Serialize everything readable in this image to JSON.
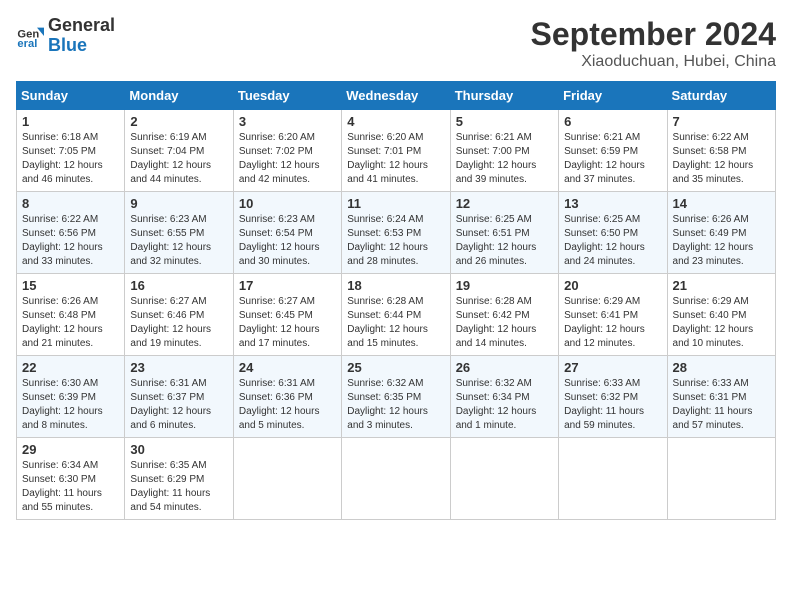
{
  "logo": {
    "line1": "General",
    "line2": "Blue"
  },
  "header": {
    "month": "September 2024",
    "location": "Xiaoduchuan, Hubei, China"
  },
  "weekdays": [
    "Sunday",
    "Monday",
    "Tuesday",
    "Wednesday",
    "Thursday",
    "Friday",
    "Saturday"
  ],
  "weeks": [
    [
      {
        "day": "1",
        "info": "Sunrise: 6:18 AM\nSunset: 7:05 PM\nDaylight: 12 hours\nand 46 minutes."
      },
      {
        "day": "2",
        "info": "Sunrise: 6:19 AM\nSunset: 7:04 PM\nDaylight: 12 hours\nand 44 minutes."
      },
      {
        "day": "3",
        "info": "Sunrise: 6:20 AM\nSunset: 7:02 PM\nDaylight: 12 hours\nand 42 minutes."
      },
      {
        "day": "4",
        "info": "Sunrise: 6:20 AM\nSunset: 7:01 PM\nDaylight: 12 hours\nand 41 minutes."
      },
      {
        "day": "5",
        "info": "Sunrise: 6:21 AM\nSunset: 7:00 PM\nDaylight: 12 hours\nand 39 minutes."
      },
      {
        "day": "6",
        "info": "Sunrise: 6:21 AM\nSunset: 6:59 PM\nDaylight: 12 hours\nand 37 minutes."
      },
      {
        "day": "7",
        "info": "Sunrise: 6:22 AM\nSunset: 6:58 PM\nDaylight: 12 hours\nand 35 minutes."
      }
    ],
    [
      {
        "day": "8",
        "info": "Sunrise: 6:22 AM\nSunset: 6:56 PM\nDaylight: 12 hours\nand 33 minutes."
      },
      {
        "day": "9",
        "info": "Sunrise: 6:23 AM\nSunset: 6:55 PM\nDaylight: 12 hours\nand 32 minutes."
      },
      {
        "day": "10",
        "info": "Sunrise: 6:23 AM\nSunset: 6:54 PM\nDaylight: 12 hours\nand 30 minutes."
      },
      {
        "day": "11",
        "info": "Sunrise: 6:24 AM\nSunset: 6:53 PM\nDaylight: 12 hours\nand 28 minutes."
      },
      {
        "day": "12",
        "info": "Sunrise: 6:25 AM\nSunset: 6:51 PM\nDaylight: 12 hours\nand 26 minutes."
      },
      {
        "day": "13",
        "info": "Sunrise: 6:25 AM\nSunset: 6:50 PM\nDaylight: 12 hours\nand 24 minutes."
      },
      {
        "day": "14",
        "info": "Sunrise: 6:26 AM\nSunset: 6:49 PM\nDaylight: 12 hours\nand 23 minutes."
      }
    ],
    [
      {
        "day": "15",
        "info": "Sunrise: 6:26 AM\nSunset: 6:48 PM\nDaylight: 12 hours\nand 21 minutes."
      },
      {
        "day": "16",
        "info": "Sunrise: 6:27 AM\nSunset: 6:46 PM\nDaylight: 12 hours\nand 19 minutes."
      },
      {
        "day": "17",
        "info": "Sunrise: 6:27 AM\nSunset: 6:45 PM\nDaylight: 12 hours\nand 17 minutes."
      },
      {
        "day": "18",
        "info": "Sunrise: 6:28 AM\nSunset: 6:44 PM\nDaylight: 12 hours\nand 15 minutes."
      },
      {
        "day": "19",
        "info": "Sunrise: 6:28 AM\nSunset: 6:42 PM\nDaylight: 12 hours\nand 14 minutes."
      },
      {
        "day": "20",
        "info": "Sunrise: 6:29 AM\nSunset: 6:41 PM\nDaylight: 12 hours\nand 12 minutes."
      },
      {
        "day": "21",
        "info": "Sunrise: 6:29 AM\nSunset: 6:40 PM\nDaylight: 12 hours\nand 10 minutes."
      }
    ],
    [
      {
        "day": "22",
        "info": "Sunrise: 6:30 AM\nSunset: 6:39 PM\nDaylight: 12 hours\nand 8 minutes."
      },
      {
        "day": "23",
        "info": "Sunrise: 6:31 AM\nSunset: 6:37 PM\nDaylight: 12 hours\nand 6 minutes."
      },
      {
        "day": "24",
        "info": "Sunrise: 6:31 AM\nSunset: 6:36 PM\nDaylight: 12 hours\nand 5 minutes."
      },
      {
        "day": "25",
        "info": "Sunrise: 6:32 AM\nSunset: 6:35 PM\nDaylight: 12 hours\nand 3 minutes."
      },
      {
        "day": "26",
        "info": "Sunrise: 6:32 AM\nSunset: 6:34 PM\nDaylight: 12 hours\nand 1 minute."
      },
      {
        "day": "27",
        "info": "Sunrise: 6:33 AM\nSunset: 6:32 PM\nDaylight: 11 hours\nand 59 minutes."
      },
      {
        "day": "28",
        "info": "Sunrise: 6:33 AM\nSunset: 6:31 PM\nDaylight: 11 hours\nand 57 minutes."
      }
    ],
    [
      {
        "day": "29",
        "info": "Sunrise: 6:34 AM\nSunset: 6:30 PM\nDaylight: 11 hours\nand 55 minutes."
      },
      {
        "day": "30",
        "info": "Sunrise: 6:35 AM\nSunset: 6:29 PM\nDaylight: 11 hours\nand 54 minutes."
      },
      null,
      null,
      null,
      null,
      null
    ]
  ]
}
